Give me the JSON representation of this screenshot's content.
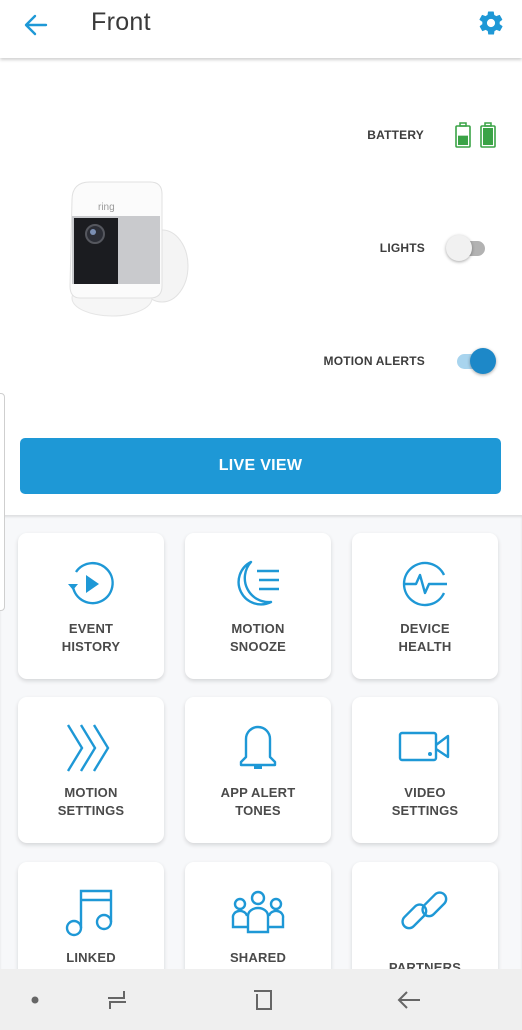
{
  "header": {
    "title": "Front",
    "back_icon": "arrow-left-icon",
    "settings_icon": "gear-icon"
  },
  "device": {
    "image": "ring-spotlight-camera",
    "brand_mark": "ring",
    "battery": {
      "label": "BATTERY",
      "batteries": [
        {
          "level": 0.55
        },
        {
          "level": 1.0
        }
      ],
      "color": "#3aa346"
    },
    "lights": {
      "label": "LIGHTS",
      "on": false
    },
    "motion_alerts": {
      "label": "MOTION ALERTS",
      "on": true
    }
  },
  "live_view": {
    "label": "LIVE VIEW",
    "color": "#1e98d6"
  },
  "accent_color": "#1e98d6",
  "tiles": [
    {
      "line1": "EVENT",
      "line2": "HISTORY",
      "icon": "event-history-icon"
    },
    {
      "line1": "MOTION",
      "line2": "SNOOZE",
      "icon": "moon-snooze-icon"
    },
    {
      "line1": "DEVICE",
      "line2": "HEALTH",
      "icon": "device-health-icon"
    },
    {
      "line1": "MOTION",
      "line2": "SETTINGS",
      "icon": "motion-chevrons-icon"
    },
    {
      "line1": "APP ALERT",
      "line2": "TONES",
      "icon": "bell-icon"
    },
    {
      "line1": "VIDEO",
      "line2": "SETTINGS",
      "icon": "video-camera-icon"
    },
    {
      "line1": "LINKED",
      "line2": "",
      "icon": "music-note-icon"
    },
    {
      "line1": "SHARED",
      "line2": "",
      "icon": "users-icon"
    },
    {
      "line1": "PARTNERS",
      "line2": "",
      "icon": "link-icon"
    }
  ],
  "navbar": {
    "items": [
      "dot-indicator",
      "recent-apps",
      "home",
      "back"
    ]
  }
}
